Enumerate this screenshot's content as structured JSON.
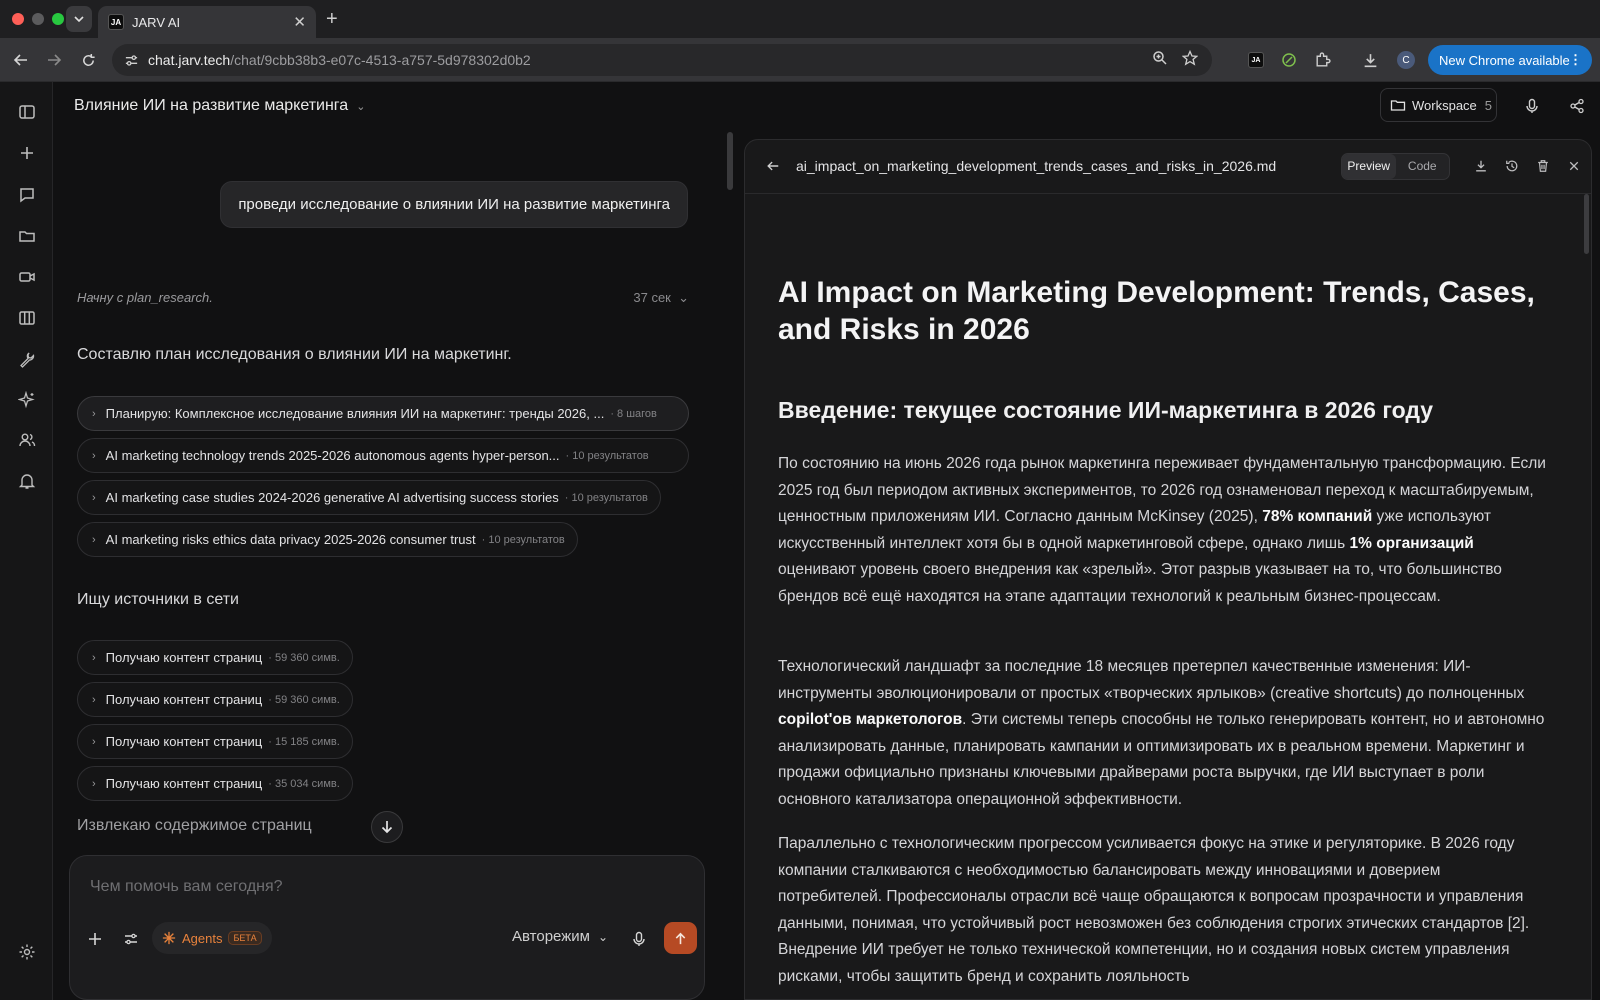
{
  "browser": {
    "tab_title": "JARV AI",
    "tab_favicon": "JA",
    "url_host": "chat.jarv.tech",
    "url_path": "/chat/9cbb38b3-e07c-4513-a757-5d978302d0b2",
    "extension_label": "JA",
    "profile_initial": "C",
    "update_label": "New Chrome available"
  },
  "header": {
    "chat_title": "Влияние ИИ на развитие маркетинга",
    "workspace_label": "Workspace",
    "workspace_count": "5"
  },
  "chat": {
    "user_message": "проведи исследование о влиянии ИИ на развитие маркетинга",
    "thinking_text": "Начну с plan_research.",
    "thinking_time": "37 сек",
    "plan_text": "Составлю план исследования о влиянии ИИ на маркетинг.",
    "steps": [
      {
        "label": "Планирую: Комплексное исследование влияния ИИ на маркетинг: тренды 2026, ...",
        "meta": "· 8 шагов"
      },
      {
        "label": "AI marketing technology trends 2025-2026 autonomous agents hyper-person...",
        "meta": "· 10 результатов"
      },
      {
        "label": "AI marketing case studies 2024-2026 generative AI advertising success stories",
        "meta": "· 10 результатов"
      },
      {
        "label": "AI marketing risks ethics data privacy 2025-2026 consumer trust",
        "meta": "· 10 результатов"
      }
    ],
    "search_text": "Ищу источники в сети",
    "fetches": [
      {
        "label": "Получаю контент страниц",
        "meta": "· 59 360 симв."
      },
      {
        "label": "Получаю контент страниц",
        "meta": "· 59 360 симв."
      },
      {
        "label": "Получаю контент страниц",
        "meta": "· 15 185 симв."
      },
      {
        "label": "Получаю контент страниц",
        "meta": "· 35 034 симв."
      }
    ],
    "extract_text": "Извлекаю содержимое страниц"
  },
  "composer": {
    "placeholder": "Чем помочь вам сегодня?",
    "agents_label": "Agents",
    "beta_label": "БЕТА",
    "mode_label": "Авторежим"
  },
  "document": {
    "filename": "ai_impact_on_marketing_development_trends_cases_and_risks_in_2026.md",
    "tab_preview": "Preview",
    "tab_code": "Code",
    "h1": "AI Impact on Marketing Development: Trends, Cases, and Risks in 2026",
    "h2": "Введение: текущее состояние ИИ-маркетинга в 2026 году",
    "p1_a": "По состоянию на июнь 2026 года рынок маркетинга переживает фундаментальную трансформацию. Если 2025 год был периодом активных экспериментов, то 2026 год ознаменовал переход к масштабируемым, ценностным приложениям ИИ. Согласно данным McKinsey (2025), ",
    "p1_b": "78% компаний",
    "p1_c": " уже используют искусственный интеллект хотя бы в одной маркетинговой сфере, однако лишь ",
    "p1_d": "1% организаций",
    "p1_e": " оценивают уровень своего внедрения как «зрелый». Этот разрыв указывает на то, что большинство брендов всё ещё находятся на этапе адаптации технологий к реальным бизнес-процессам.",
    "p2_a": "Технологический ландшафт за последние 18 месяцев претерпел качественные изменения: ИИ-инструменты эволюционировали от простых «творческих ярлыков» (creative shortcuts) до полноценных ",
    "p2_b": "copilot'ов маркетологов",
    "p2_c": ". Эти системы теперь способны не только генерировать контент, но и автономно анализировать данные, планировать кампании и оптимизировать их в реальном времени. Маркетинг и продажи официально признаны ключевыми драйверами роста выручки, где ИИ выступает в роли основного катализатора операционной эффективности.",
    "p3": "Параллельно с технологическим прогрессом усиливается фокус на этике и регуляторике. В 2026 году компании сталкиваются с необходимостью балансировать между инновациями и доверием потребителей. Профессионалы отрасли всё чаще обращаются к вопросам прозрачности и управления данными, понимая, что устойчивый рост невозможен без соблюдения строгих этических стандартов [2]. Внедрение ИИ требует не только технической компетенции, но и создания новых систем управления рисками, чтобы защитить бренд и сохранить лояльность"
  },
  "colors": {
    "accent": "#b64a24",
    "agents": "#e8823c",
    "chrome_update": "#1a73c7"
  }
}
